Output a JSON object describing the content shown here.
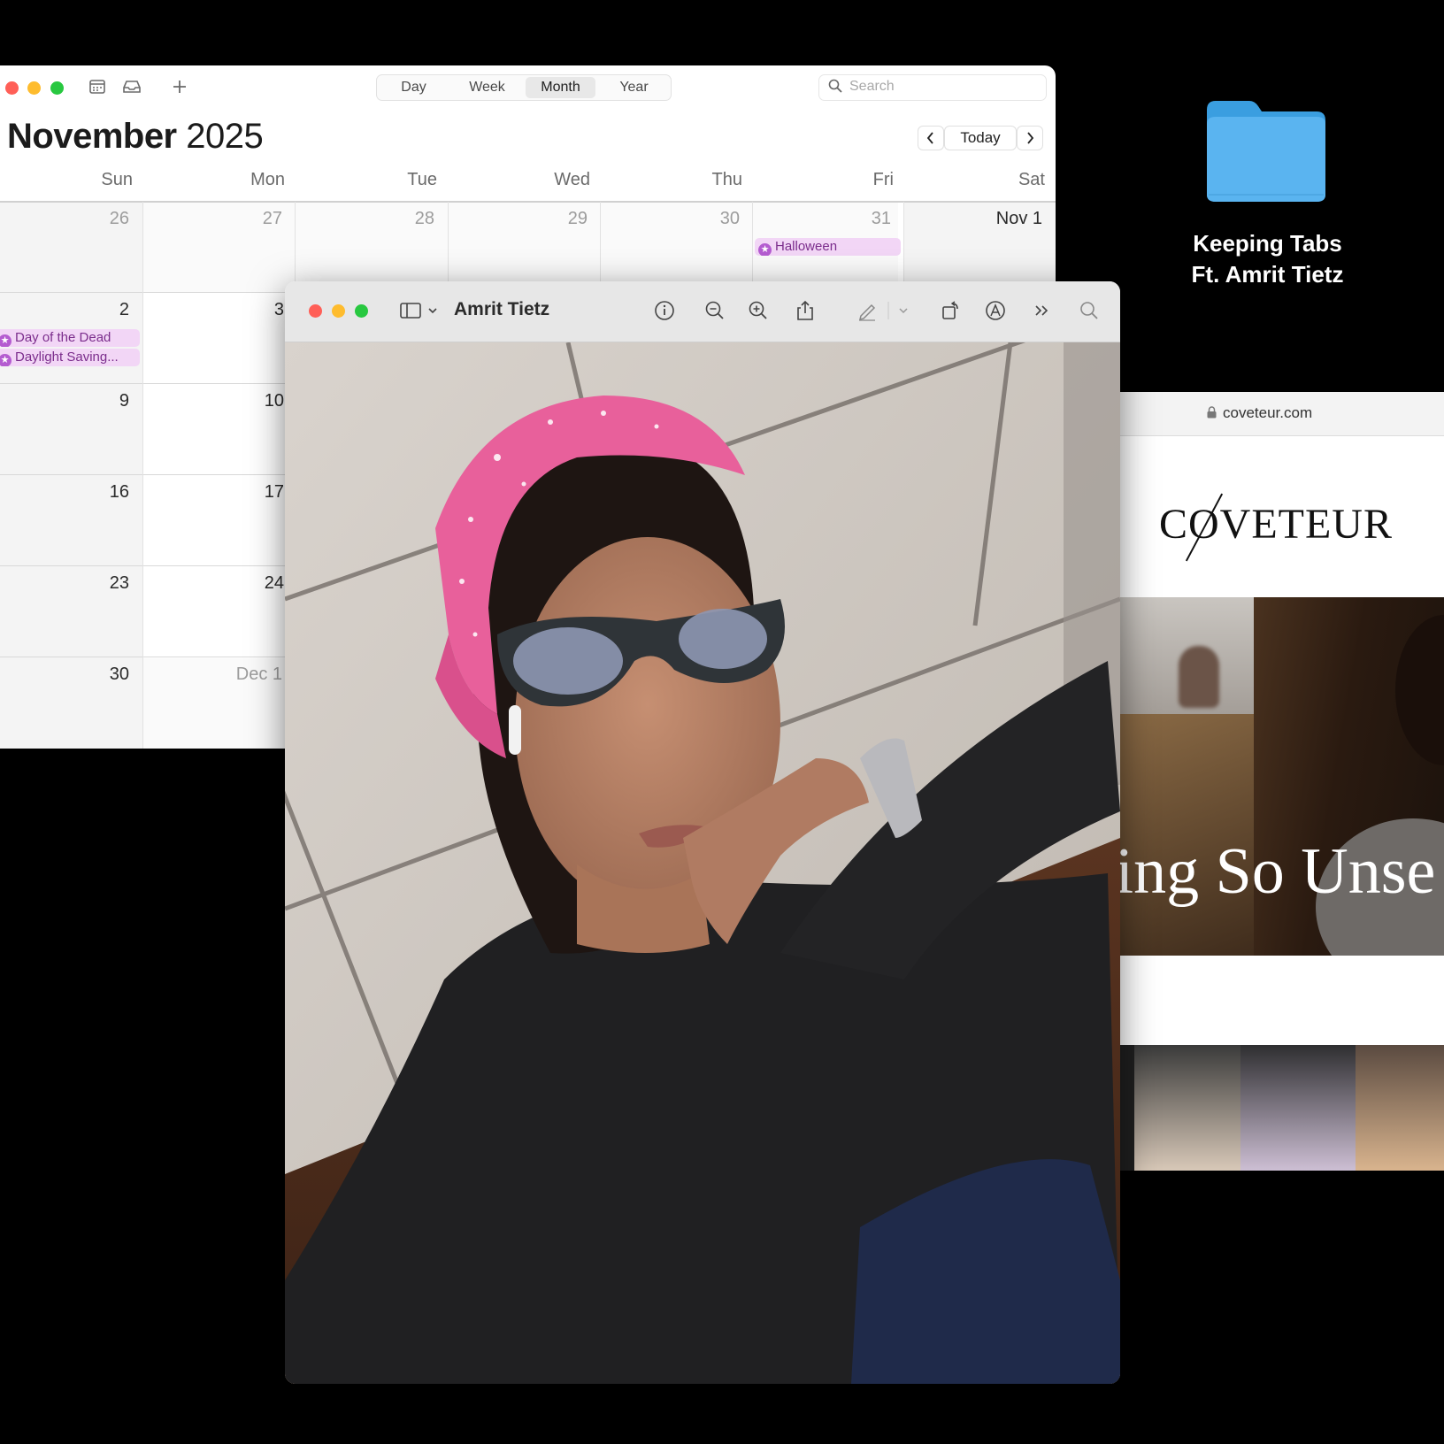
{
  "calendar": {
    "view_tabs": [
      {
        "label": "Day",
        "active": false
      },
      {
        "label": "Week",
        "active": false
      },
      {
        "label": "Month",
        "active": true
      },
      {
        "label": "Year",
        "active": false
      }
    ],
    "search_placeholder": "Search",
    "month": "November",
    "year": "2025",
    "today_label": "Today",
    "weekdays": [
      "Sun",
      "Mon",
      "Tue",
      "Wed",
      "Thu",
      "Fri",
      "Sat"
    ],
    "weeks": [
      [
        "26",
        "27",
        "28",
        "29",
        "30",
        "31",
        "Nov 1"
      ],
      [
        "2",
        "3"
      ],
      [
        "9",
        "10"
      ],
      [
        "16",
        "17"
      ],
      [
        "23",
        "24"
      ],
      [
        "30",
        "Dec 1"
      ]
    ],
    "events": {
      "halloween": "Halloween",
      "day_of_dead": "Day of the Dead",
      "daylight": "Daylight Saving..."
    }
  },
  "folder": {
    "line1": "Keeping Tabs",
    "line2": "Ft. Amrit Tietz",
    "color": "#5ab4f0"
  },
  "browser": {
    "url": "coveteur.com",
    "logo": "COVETEUR",
    "hero_headline": "ting So Unse"
  },
  "preview": {
    "title": "Amrit Tietz"
  },
  "colors": {
    "traffic_red": "#ff5f57",
    "traffic_yellow": "#febc2e",
    "traffic_green": "#28c840",
    "event_bg": "#f2d6f6",
    "event_text": "#7b2d8c"
  }
}
